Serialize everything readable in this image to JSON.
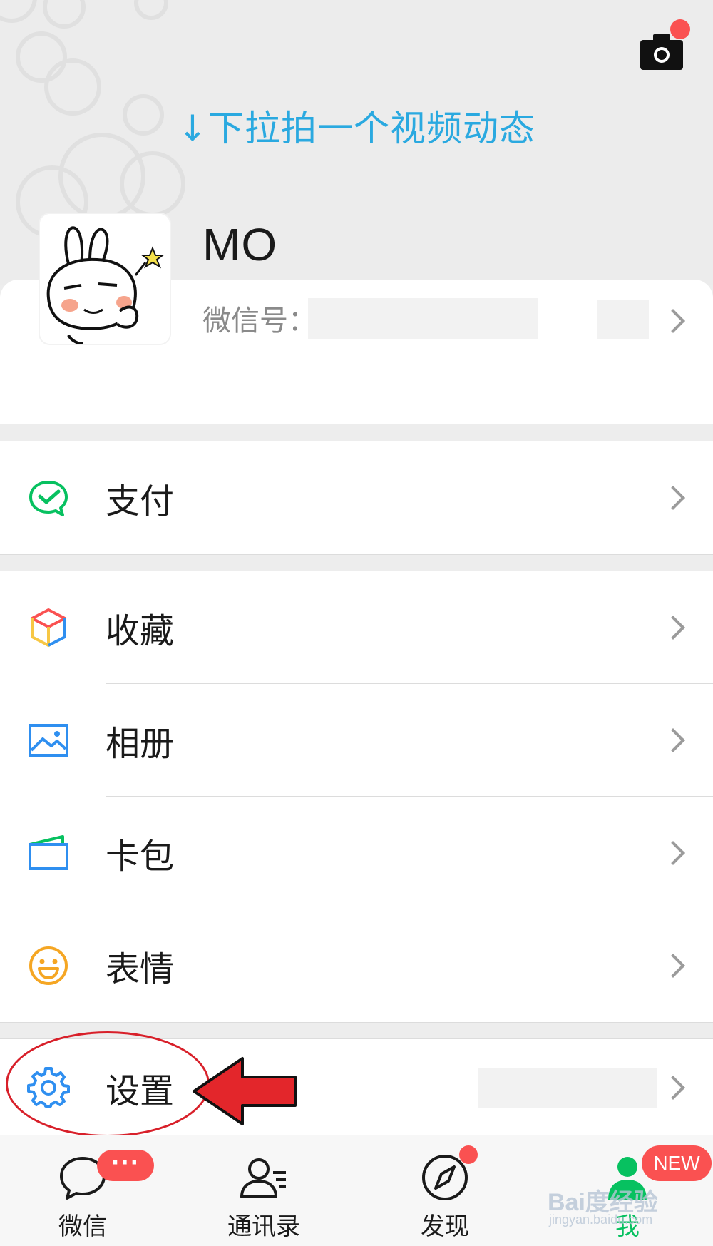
{
  "header": {
    "pull_hint": "↓下拉拍一个视频动态"
  },
  "profile": {
    "name": "MO",
    "wechat_id_label": "微信号："
  },
  "menu": {
    "pay": {
      "label": "支付",
      "icon": "wechat-pay-icon"
    },
    "favorites": {
      "label": "收藏",
      "icon": "favorites-cube-icon"
    },
    "album": {
      "label": "相册",
      "icon": "album-image-icon"
    },
    "cards": {
      "label": "卡包",
      "icon": "card-wallet-icon"
    },
    "stickers": {
      "label": "表情",
      "icon": "smiley-icon"
    },
    "settings": {
      "label": "设置",
      "icon": "gear-icon"
    }
  },
  "tabbar": {
    "tabs": [
      {
        "label": "微信",
        "icon": "chat-bubble-icon",
        "badge": "···"
      },
      {
        "label": "通讯录",
        "icon": "contacts-icon"
      },
      {
        "label": "发现",
        "icon": "compass-icon"
      },
      {
        "label": "我",
        "icon": "person-icon",
        "badge": "NEW",
        "active": true
      }
    ]
  },
  "watermark": {
    "text": "Bai度经验",
    "url_text": "jingyan.baidu.com"
  },
  "colors": {
    "accent_green": "#07c160",
    "badge_red": "#fa5151",
    "hint_blue": "#2aa9e0",
    "annotation_red": "#d8202a"
  }
}
